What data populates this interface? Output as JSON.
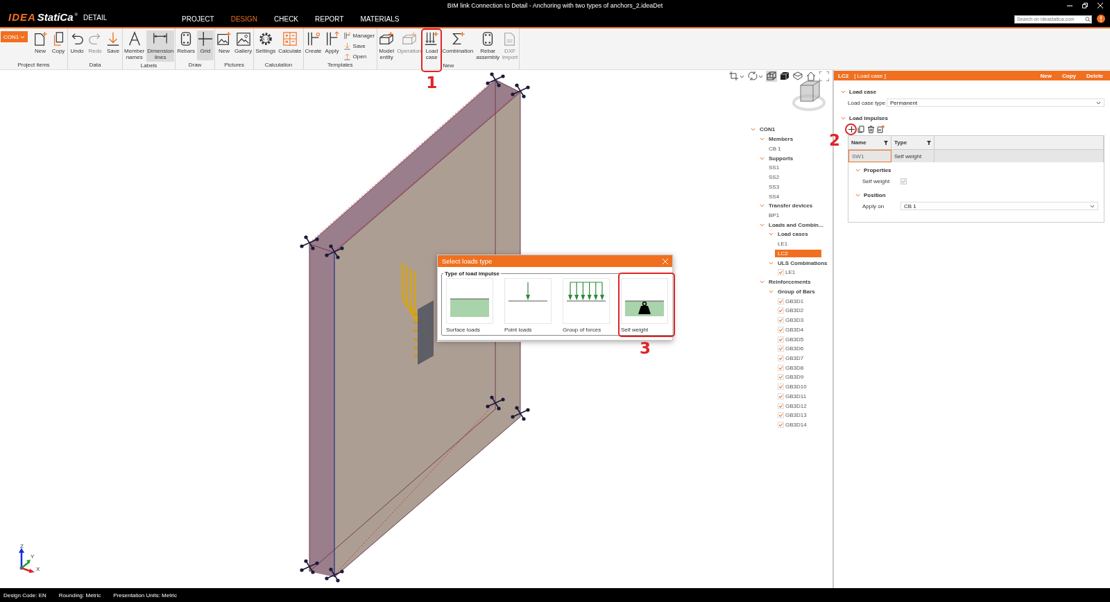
{
  "window": {
    "title": "BIM link Connection to Detail - Anchoring with two types of anchors_2.ideaDet"
  },
  "logo": {
    "brand_1": "IDEA",
    "brand_2": "StatiCa",
    "registered": "®",
    "product": "DETAIL"
  },
  "menu_tabs": [
    {
      "label": "PROJECT",
      "selected": false
    },
    {
      "label": "DESIGN",
      "selected": true
    },
    {
      "label": "CHECK",
      "selected": false
    },
    {
      "label": "REPORT",
      "selected": false
    },
    {
      "label": "MATERIALS",
      "selected": false
    }
  ],
  "search": {
    "placeholder": "Search on ideastatica.com"
  },
  "ribbon": {
    "groups": [
      {
        "title": "Project items",
        "items": [
          {
            "kind": "dropdown",
            "label": "CON1"
          },
          {
            "kind": "large",
            "label": "New",
            "disabled": false,
            "on": false
          },
          {
            "kind": "large",
            "label": "Copy",
            "disabled": false,
            "on": false
          }
        ]
      },
      {
        "title": "Data",
        "items": [
          {
            "kind": "large",
            "label": "Undo",
            "disabled": false,
            "on": false
          },
          {
            "kind": "large",
            "label": "Redo",
            "disabled": true,
            "on": false
          },
          {
            "kind": "large",
            "label": "Save",
            "disabled": false,
            "on": false
          }
        ]
      },
      {
        "title": "Labels",
        "items": [
          {
            "kind": "large",
            "label": "Member names",
            "disabled": false,
            "on": false
          },
          {
            "kind": "large",
            "label": "Dimension lines",
            "disabled": false,
            "on": true
          }
        ]
      },
      {
        "title": "Draw",
        "items": [
          {
            "kind": "large",
            "label": "Rebars",
            "disabled": false,
            "on": false
          },
          {
            "kind": "large",
            "label": "Grid",
            "disabled": false,
            "on": true
          }
        ]
      },
      {
        "title": "Pictures",
        "items": [
          {
            "kind": "large",
            "label": "New",
            "disabled": false,
            "on": false
          },
          {
            "kind": "large",
            "label": "Gallery",
            "disabled": false,
            "on": false
          }
        ]
      },
      {
        "title": "Calculation",
        "items": [
          {
            "kind": "large",
            "label": "Settings",
            "disabled": false,
            "on": false
          },
          {
            "kind": "large",
            "label": "Calculate",
            "disabled": false,
            "on": false
          }
        ]
      },
      {
        "title": "Templates",
        "items": [
          {
            "kind": "large",
            "label": "Create",
            "disabled": false,
            "on": false
          },
          {
            "kind": "large",
            "label": "Apply",
            "disabled": false,
            "on": false
          },
          {
            "kind": "small",
            "label": "Manager",
            "disabled": false,
            "on": false
          },
          {
            "kind": "small",
            "label": "Save",
            "disabled": false,
            "on": false
          },
          {
            "kind": "small",
            "label": "Open",
            "disabled": false,
            "on": false
          }
        ]
      },
      {
        "title": "New",
        "items": [
          {
            "kind": "large",
            "label": "Model entity",
            "disabled": false,
            "on": false
          },
          {
            "kind": "large",
            "label": "Operation",
            "disabled": true,
            "on": false
          },
          {
            "kind": "large",
            "label": "Load case",
            "disabled": false,
            "on": false,
            "annotation": "1"
          },
          {
            "kind": "large",
            "label": "Combination",
            "disabled": false,
            "on": false
          },
          {
            "kind": "large",
            "label": "Rebar assembly",
            "disabled": false,
            "on": false
          },
          {
            "kind": "large",
            "label": "DXF import",
            "disabled": true,
            "on": false
          }
        ]
      }
    ]
  },
  "viewport": {
    "tools": [
      {
        "on": false
      },
      {
        "on": false
      },
      {
        "on": true
      },
      {
        "on": false
      },
      {
        "on": false
      },
      {
        "on": false
      },
      {
        "on": false
      }
    ],
    "axis_labels": [
      "Z",
      "Y",
      "X"
    ]
  },
  "tree": {
    "items": [
      {
        "label": "CON1",
        "expanded": true,
        "selected": false,
        "children": [
          {
            "label": "Members",
            "expanded": true,
            "selected": false,
            "children": [
              {
                "label": "CB 1",
                "selected": false
              }
            ]
          },
          {
            "label": "Supports",
            "expanded": true,
            "selected": false,
            "children": [
              {
                "label": "SS1",
                "selected": false
              },
              {
                "label": "SS2",
                "selected": false
              },
              {
                "label": "SS3",
                "selected": false
              },
              {
                "label": "SS4",
                "selected": false
              }
            ]
          },
          {
            "label": "Transfer devices",
            "expanded": true,
            "selected": false,
            "children": [
              {
                "label": "BP1",
                "selected": false
              }
            ]
          },
          {
            "label": "Loads and Combin...",
            "expanded": true,
            "selected": false,
            "children": [
              {
                "label": "Load cases",
                "expanded": true,
                "selected": false,
                "children": [
                  {
                    "label": "LE1",
                    "selected": false
                  },
                  {
                    "label": "LC2",
                    "selected": true
                  }
                ]
              },
              {
                "label": "ULS Combinations",
                "expanded": true,
                "selected": false,
                "children": [
                  {
                    "label": "LE1",
                    "checked": true,
                    "selected": false
                  }
                ]
              }
            ]
          },
          {
            "label": "Reinforcements",
            "expanded": true,
            "selected": false,
            "children": [
              {
                "label": "Group of Bars",
                "expanded": true,
                "selected": false,
                "children": [
                  {
                    "label": "GB3D1",
                    "checked": true,
                    "selected": false
                  },
                  {
                    "label": "GB3D2",
                    "checked": true,
                    "selected": false
                  },
                  {
                    "label": "GB3D3",
                    "checked": true,
                    "selected": false
                  },
                  {
                    "label": "GB3D4",
                    "checked": true,
                    "selected": false
                  },
                  {
                    "label": "GB3D5",
                    "checked": true,
                    "selected": false
                  },
                  {
                    "label": "GB3D6",
                    "checked": true,
                    "selected": false
                  },
                  {
                    "label": "GB3D7",
                    "checked": true,
                    "selected": false
                  },
                  {
                    "label": "GB3D8",
                    "checked": true,
                    "selected": false
                  },
                  {
                    "label": "GB3D9",
                    "checked": true,
                    "selected": false
                  },
                  {
                    "label": "GB3D10",
                    "checked": true,
                    "selected": false
                  },
                  {
                    "label": "GB3D11",
                    "checked": true,
                    "selected": false
                  },
                  {
                    "label": "GB3D12",
                    "checked": true,
                    "selected": false
                  },
                  {
                    "label": "GB3D13",
                    "checked": true,
                    "selected": false
                  },
                  {
                    "label": "GB3D14",
                    "checked": true,
                    "selected": false
                  }
                ]
              }
            ]
          }
        ]
      }
    ]
  },
  "dialog": {
    "title": "Select loads type",
    "group_title": "Type of load impulse",
    "options": [
      {
        "label": "Surface loads"
      },
      {
        "label": "Point loads"
      },
      {
        "label": "Group of forces"
      },
      {
        "label": "Self weight",
        "annotation": "3"
      }
    ]
  },
  "panel": {
    "name": "LC2",
    "type": "[ Load case ]",
    "actions": [
      "New",
      "Copy",
      "Delete"
    ],
    "load_case": {
      "title": "Load case",
      "expanded": true,
      "type_label": "Load case type",
      "type_value": "Permanent"
    },
    "load_impulses": {
      "title": "Load impulses",
      "expanded": true,
      "add_annotation": "2",
      "columns": [
        "Name",
        "Type"
      ],
      "rows": [
        {
          "cells": [
            "SW1",
            "Self weight"
          ],
          "selected": true
        }
      ]
    },
    "properties": {
      "title": "Properties",
      "expanded": true,
      "self_weight_label": "Self weight",
      "self_weight_checked": true,
      "self_weight_disabled": true
    },
    "position": {
      "title": "Position",
      "expanded": true,
      "apply_on_label": "Apply on",
      "apply_on_value": "CB 1"
    }
  },
  "status_bar": [
    "Design Code: EN",
    "Rounding: Metric",
    "Presentation Units: Metric"
  ]
}
